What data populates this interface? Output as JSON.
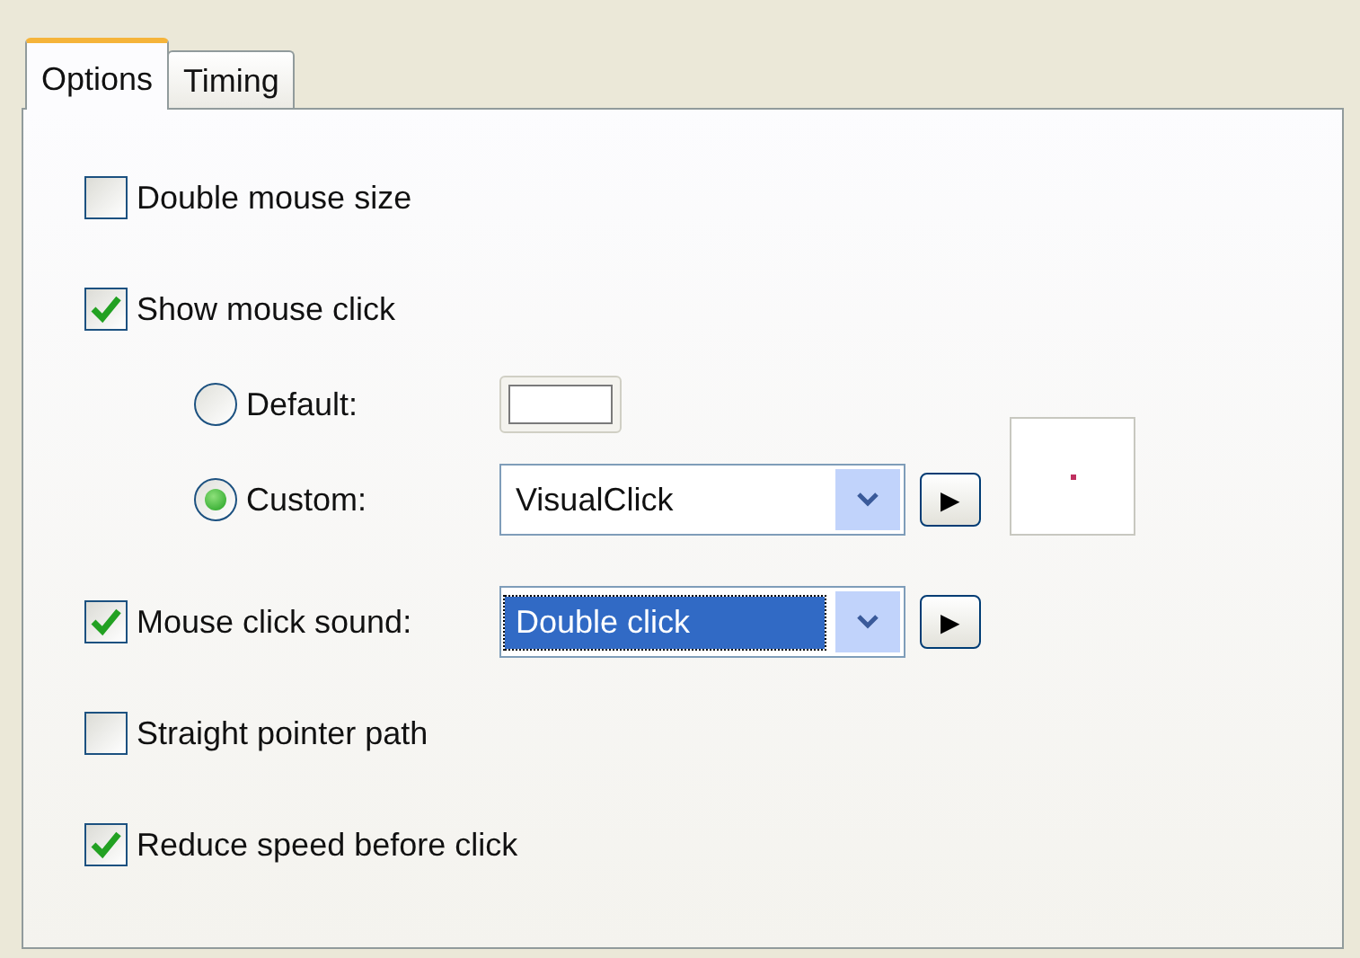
{
  "tabs": [
    {
      "label": "Options",
      "selected": true
    },
    {
      "label": "Timing",
      "selected": false
    }
  ],
  "rows": [
    {
      "kind": "checkbox",
      "label": "Double mouse size",
      "checked": false
    },
    {
      "kind": "checkbox",
      "label": "Show mouse click",
      "checked": true
    },
    {
      "kind": "radio",
      "label": "Default:",
      "selected": false,
      "swatch": true
    },
    {
      "kind": "radio",
      "label": "Custom:",
      "selected": true,
      "dropdown": {
        "value": "VisualClick",
        "focused": false
      },
      "play": "▶",
      "preview": true
    },
    {
      "kind": "checkbox",
      "label": "Mouse click sound:",
      "checked": true,
      "dropdown": {
        "value": "Double click",
        "focused": true
      },
      "play": "▶"
    },
    {
      "kind": "checkbox",
      "label": "Straight pointer path",
      "checked": false
    },
    {
      "kind": "checkbox",
      "label": "Reduce speed before click",
      "checked": true
    }
  ]
}
